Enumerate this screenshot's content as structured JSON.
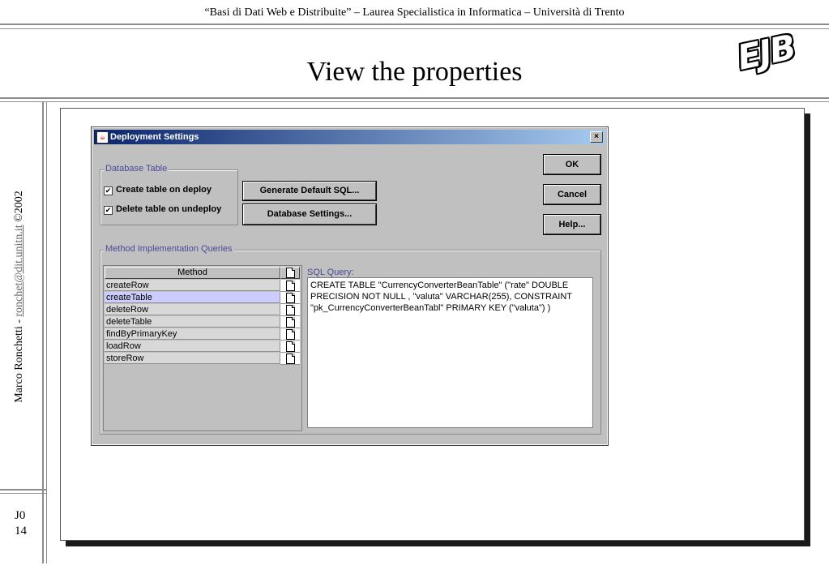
{
  "slide": {
    "header": "“Basi di Dati Web e Distribuite” – Laurea Specialistica in Informatica – Università di Trento",
    "title": "View the properties",
    "logo": "EJB",
    "author": "Marco Ronchetti",
    "separator": "-",
    "email": "ronchet@dit.unitn.it",
    "copyright": "©2002",
    "slide_code": "J0",
    "slide_number": "14"
  },
  "dialog": {
    "title": "Deployment Settings",
    "close": "×",
    "database_table_group": "Database Table",
    "create_table_label": "Create table on deploy",
    "create_table_checked": true,
    "delete_table_label": "Delete table on undeploy",
    "delete_table_checked": true,
    "generate_sql_button": "Generate Default SQL...",
    "database_settings_button": "Database Settings...",
    "ok_button": "OK",
    "cancel_button": "Cancel",
    "help_button": "Help...",
    "method_group": "Method Implementation Queries",
    "table_header": "Method",
    "methods": [
      "createRow",
      "createTable",
      "deleteRow",
      "deleteTable",
      "findByPrimaryKey",
      "loadRow",
      "storeRow"
    ],
    "selected_method": "createTable",
    "sql_label": "SQL Query:",
    "sql_query": "CREATE TABLE \"CurrencyConverterBeanTable\" (\"rate\" DOUBLE PRECISION NOT NULL , \"valuta\" VARCHAR(255), CONSTRAINT \"pk_CurrencyConverterBeanTabl\" PRIMARY KEY (\"valuta\") )"
  }
}
